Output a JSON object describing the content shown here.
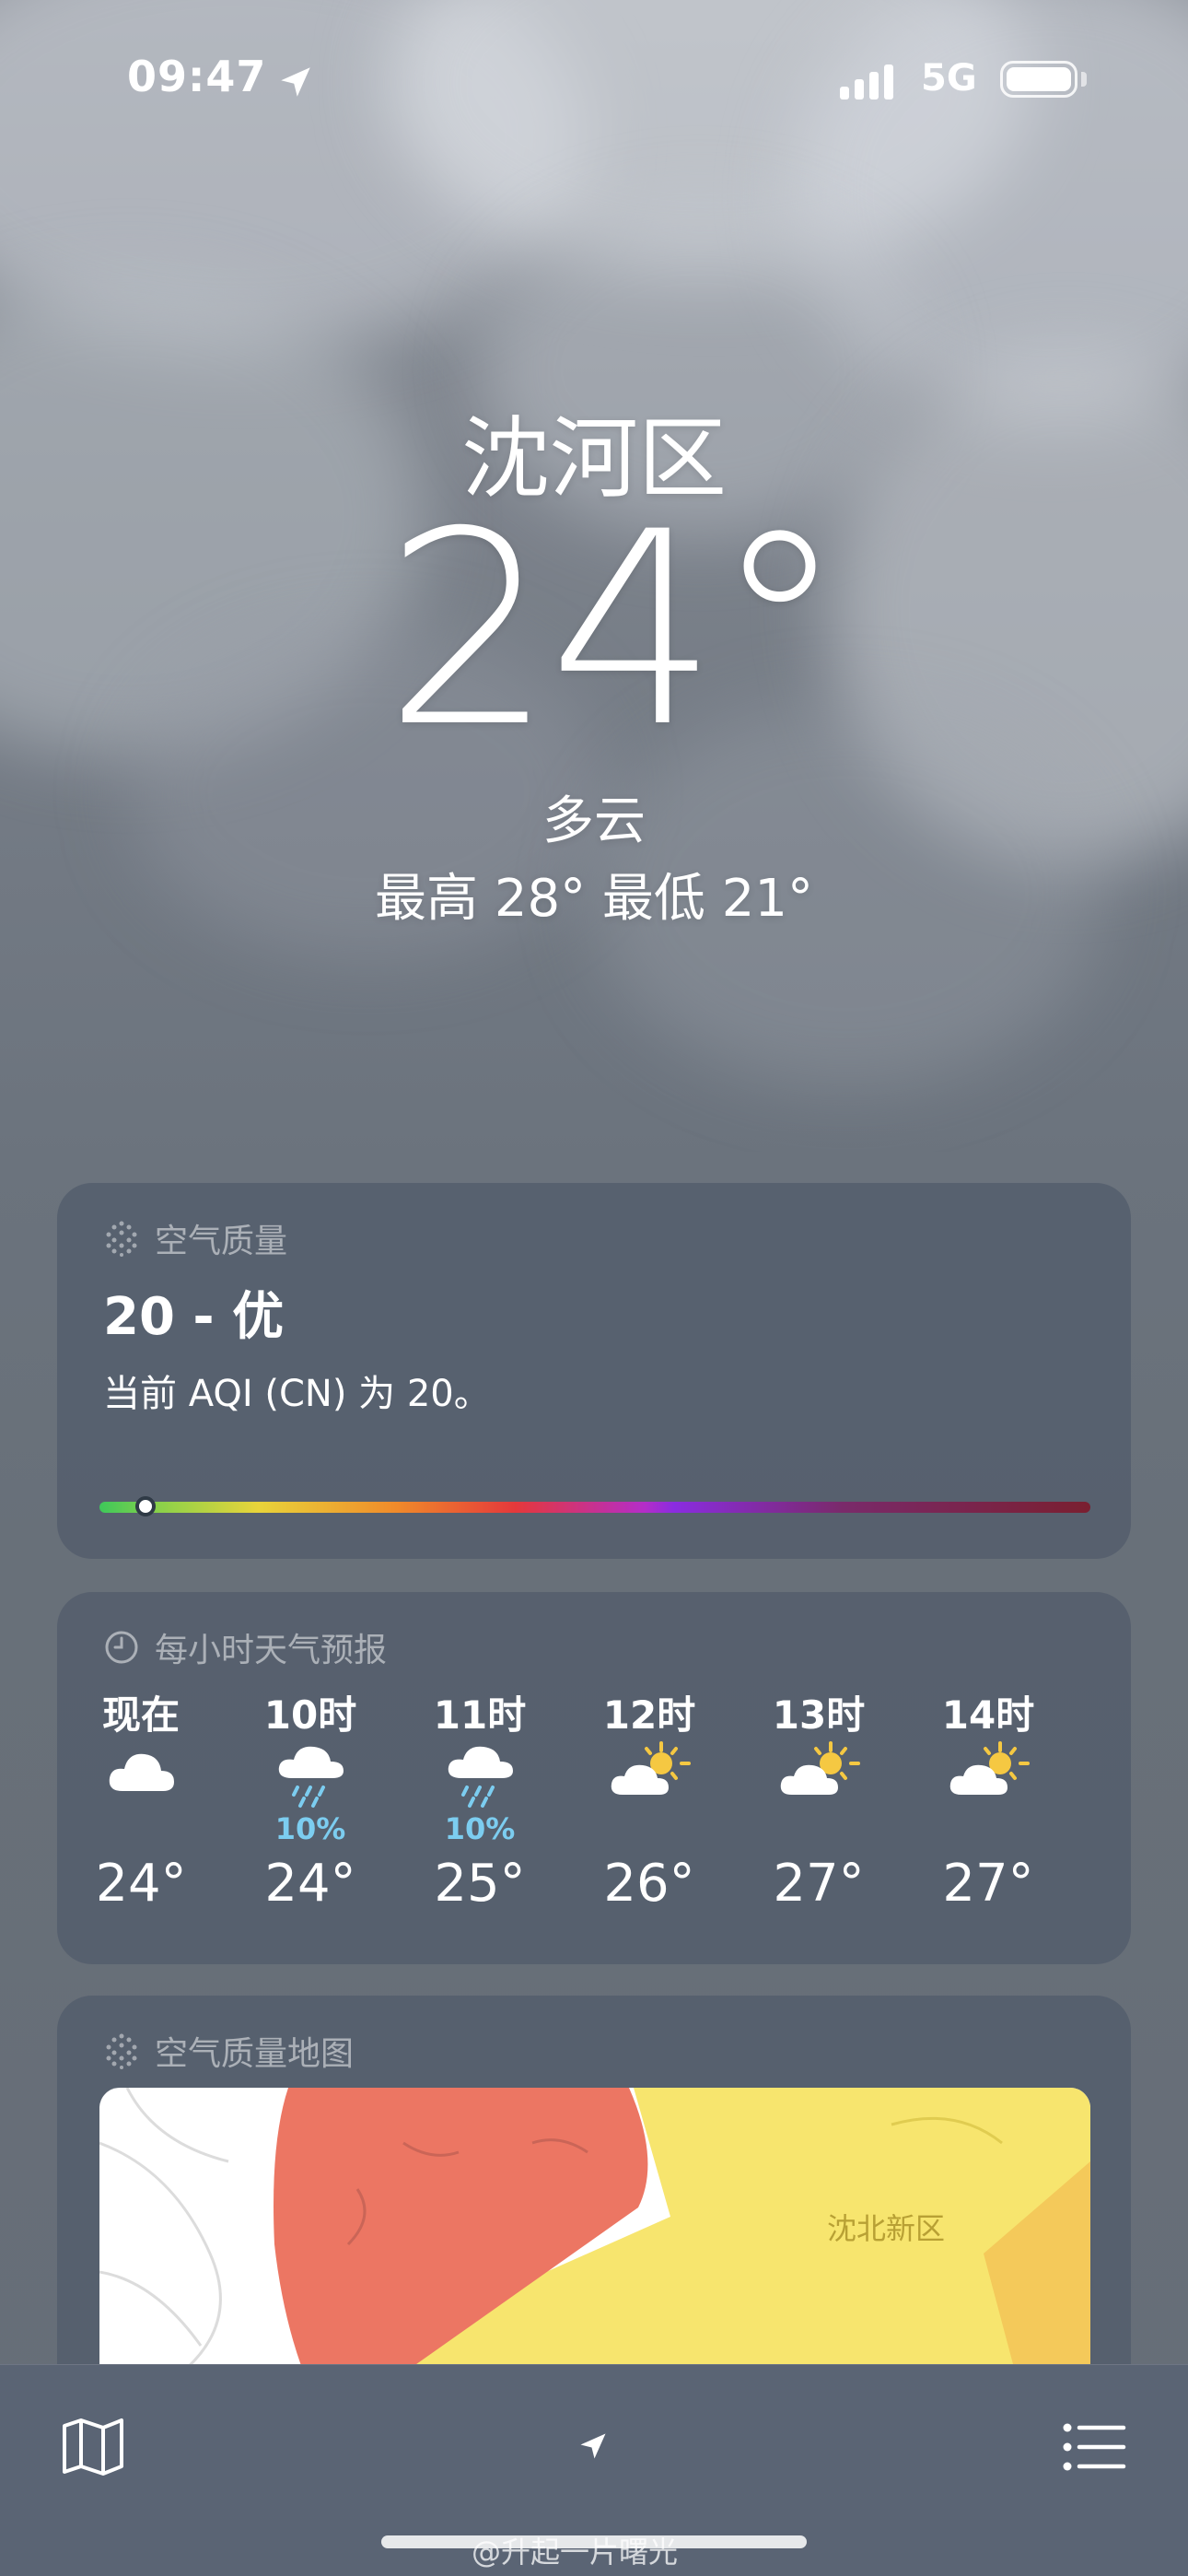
{
  "status_bar": {
    "time": "09:47",
    "network": "5G"
  },
  "location": {
    "city": "沈河区",
    "temperature": "24°",
    "condition": "多云",
    "high_low": "最高 28°  最低 21°"
  },
  "air_quality": {
    "title": "空气质量",
    "value": "20 - 优",
    "description": "当前 AQI (CN) 为 20。",
    "level_fraction": 0.04
  },
  "hourly": {
    "title": "每小时天气预报",
    "items": [
      {
        "label": "现在",
        "icon": "cloud-icon",
        "precip": "",
        "temp": "24°"
      },
      {
        "label": "10时",
        "icon": "rain-icon",
        "precip": "10%",
        "temp": "24°"
      },
      {
        "label": "11时",
        "icon": "rain-icon",
        "precip": "10%",
        "temp": "25°"
      },
      {
        "label": "12时",
        "icon": "partly-sunny-icon",
        "precip": "",
        "temp": "26°"
      },
      {
        "label": "13时",
        "icon": "partly-sunny-icon",
        "precip": "",
        "temp": "27°"
      },
      {
        "label": "14时",
        "icon": "partly-sunny-icon",
        "precip": "",
        "temp": "27°"
      }
    ]
  },
  "aq_map": {
    "title": "空气质量地图",
    "district_label": "沈北新区"
  },
  "watermark": "@升起一片曙光",
  "colors": {
    "aqi_good": "#3ec85a",
    "precip": "#7ccdf0",
    "map_red": "#ec7663",
    "map_yellow": "#f7e56e"
  }
}
